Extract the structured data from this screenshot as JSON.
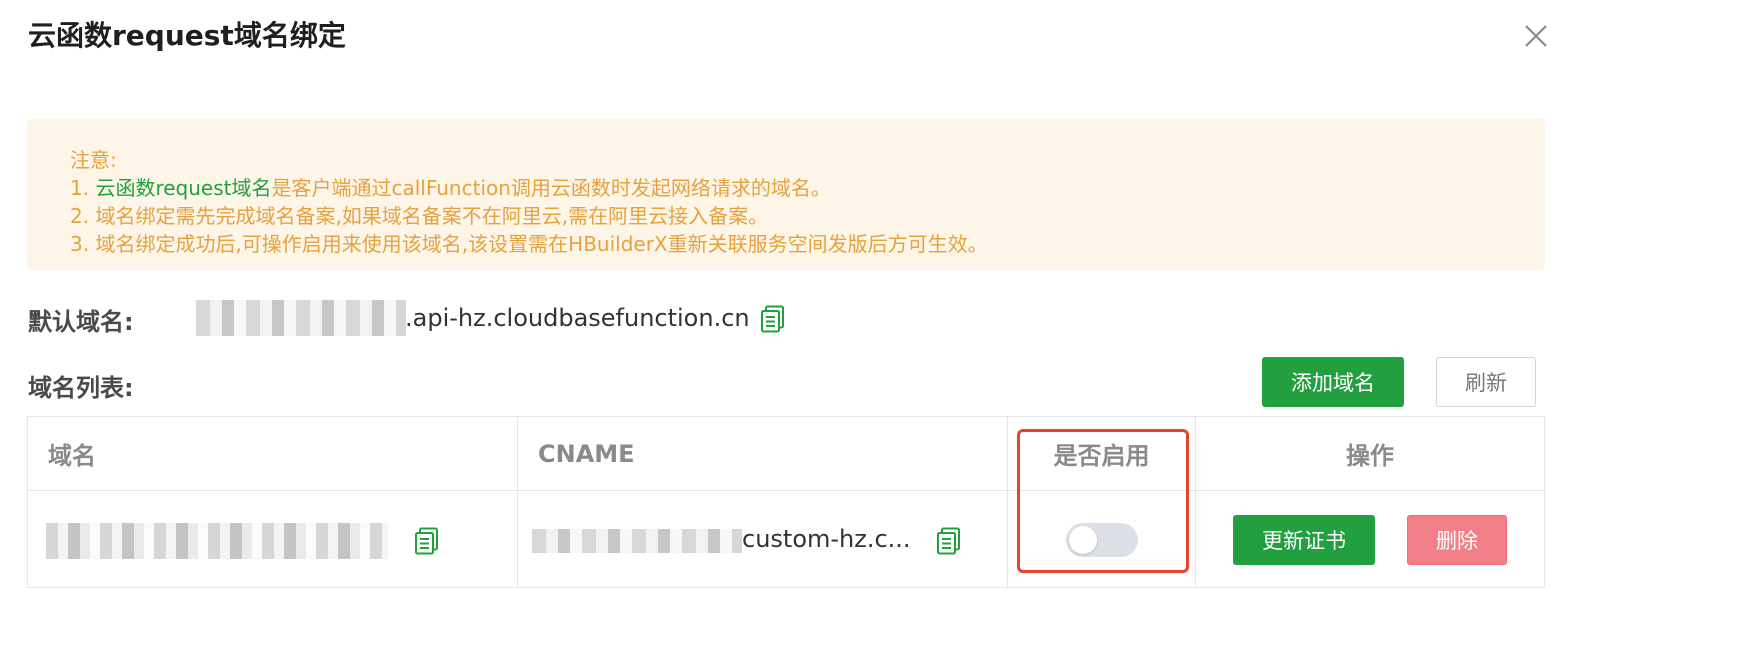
{
  "dialog": {
    "title": "云函数request域名绑定"
  },
  "notice": {
    "heading": "注意:",
    "item1_prefix": "1.  ",
    "item1_highlight": "云函数request域名",
    "item1_rest": "是客户端通过callFunction调用云函数时发起网络请求的域名。",
    "item2": "2. 域名绑定需先完成域名备案,如果域名备案不在阿里云,需在阿里云接入备案。",
    "item3": "3. 域名绑定成功后,可操作启用来使用该域名,该设置需在HBuilderX重新关联服务空间发版后方可生效。"
  },
  "default_domain": {
    "label": "默认域名:",
    "suffix": ".api-hz.cloudbasefunction.cn",
    "copy_icon": "copy-icon"
  },
  "domain_list": {
    "label": "域名列表:",
    "add_button": "添加域名",
    "refresh_button": "刷新"
  },
  "table": {
    "headers": [
      "域名",
      "CNAME",
      "是否启用",
      "操作"
    ],
    "rows": [
      {
        "cname_suffix": "custom-hz.c...",
        "enabled": false,
        "update_button": "更新证书",
        "delete_button": "删除"
      }
    ]
  },
  "colors": {
    "primary_green": "#22a03f",
    "notice_bg": "#fdf5e8",
    "notice_text": "#e6a23c",
    "danger": "#f38088",
    "highlight_border": "#e2442c"
  }
}
